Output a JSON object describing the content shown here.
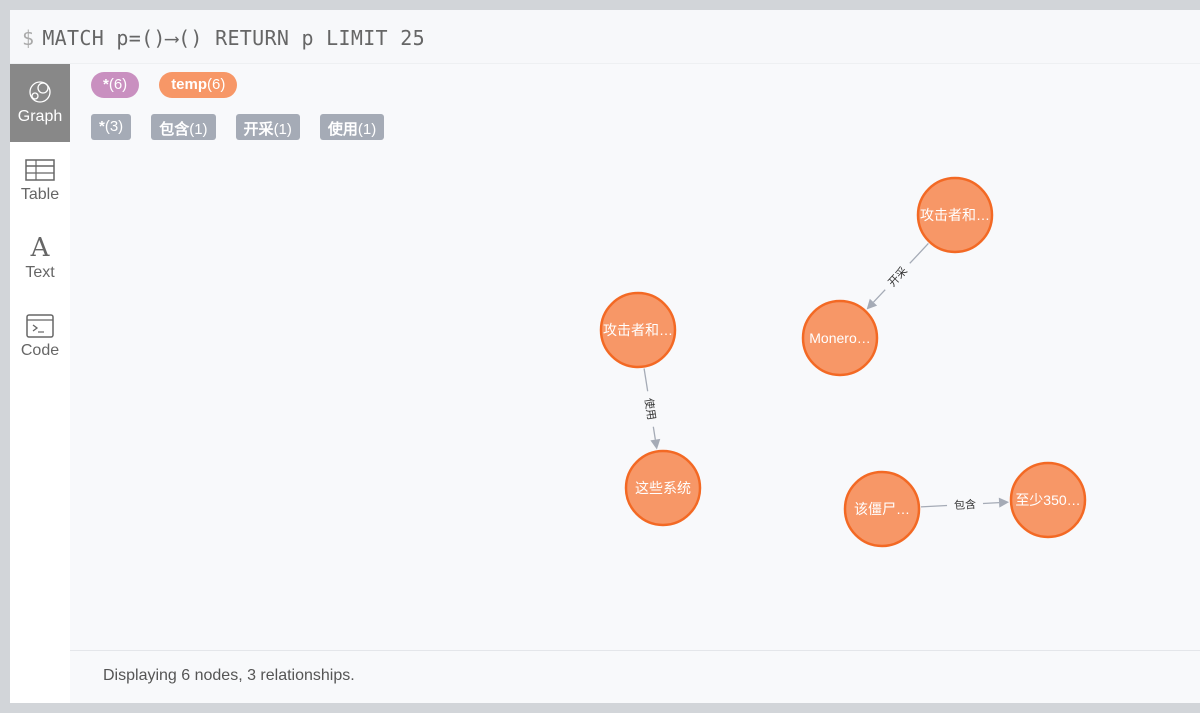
{
  "query": {
    "prompt": "$",
    "text": "MATCH p=()⟶() RETURN p LIMIT 25"
  },
  "sidebar": {
    "items": [
      {
        "label": "Graph",
        "icon": "graph-icon",
        "active": true
      },
      {
        "label": "Table",
        "icon": "table-icon"
      },
      {
        "label": "Text",
        "icon": "text-icon",
        "glyph": "A"
      },
      {
        "label": "Code",
        "icon": "code-icon"
      }
    ]
  },
  "labels": [
    {
      "name": "*",
      "count": "(6)",
      "color": "#c990c0"
    },
    {
      "name": "temp",
      "count": "(6)",
      "color": "#f79767"
    }
  ],
  "relationships": [
    {
      "name": "*",
      "count": "(3)"
    },
    {
      "name": "包含",
      "count": "(1)"
    },
    {
      "name": "开采",
      "count": "(1)"
    },
    {
      "name": "使用",
      "count": "(1)"
    }
  ],
  "graph": {
    "node_fill": "#f79767",
    "node_stroke": "#f36924",
    "edge_color": "#a5abb6",
    "nodes": [
      {
        "id": "a1",
        "caption": "攻击者和…"
      },
      {
        "id": "m",
        "caption": "Monero…"
      },
      {
        "id": "a2",
        "caption": "攻击者和…"
      },
      {
        "id": "s",
        "caption": "这些系统"
      },
      {
        "id": "z",
        "caption": "该僵尸…"
      },
      {
        "id": "t",
        "caption": "至少350…"
      }
    ],
    "edges": [
      {
        "from": "a1",
        "to": "m",
        "label": "开采"
      },
      {
        "from": "a2",
        "to": "s",
        "label": "使用"
      },
      {
        "from": "z",
        "to": "t",
        "label": "包含"
      }
    ]
  },
  "footer": "Displaying 6 nodes, 3 relationships."
}
